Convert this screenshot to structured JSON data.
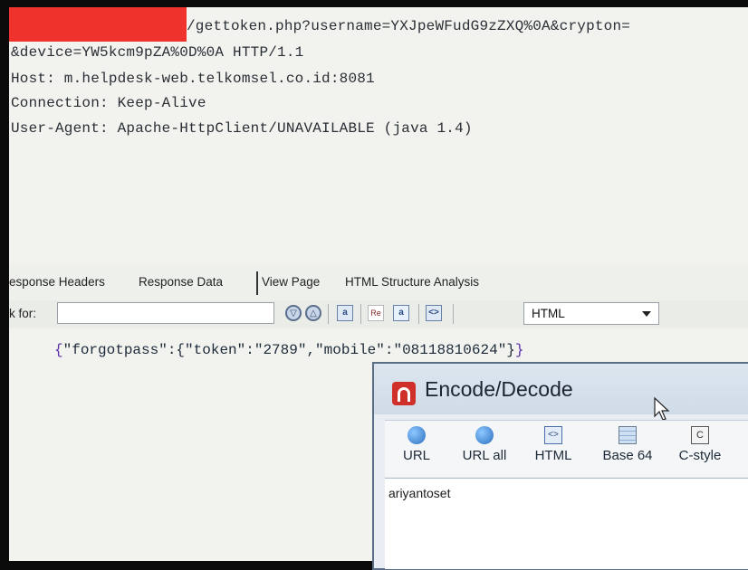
{
  "request": {
    "lines": [
      "/gettoken.php?username=YXJpeWFudG9zZXQ%0A&crypton=",
      "&device=YW5kcm9pZA%0D%0A HTTP/1.1",
      "Host: m.helpdesk-web.telkomsel.co.id:8081",
      "Connection: Keep-Alive",
      "User-Agent: Apache-HttpClient/UNAVAILABLE (java 1.4)"
    ]
  },
  "tabs": [
    {
      "label": "esponse Headers"
    },
    {
      "label": "Response Data"
    },
    {
      "label": "View Page"
    },
    {
      "label": "HTML Structure Analysis"
    }
  ],
  "toolbar": {
    "look_label": "k for:",
    "icons": [
      "search-down-icon",
      "search-up-icon",
      "match-case-icon",
      "regex-icon",
      "replace-icon",
      "html-tag-icon"
    ],
    "mode_value": "HTML"
  },
  "response": {
    "open": "{",
    "body": "\"forgotpass\":{\"token\":\"2789\",\"mobile\":\"08118810624\"}",
    "close": "}"
  },
  "dialog": {
    "title": "Encode/Decode",
    "buttons": [
      {
        "label": "URL",
        "icon": "globe-link-icon"
      },
      {
        "label": "URL all",
        "icon": "globe-link-icon"
      },
      {
        "label": "HTML",
        "icon": "html-tag-icon"
      },
      {
        "label": "Base 64",
        "icon": "grid-icon"
      },
      {
        "label": "C-style",
        "icon": "c-icon"
      }
    ],
    "text_value": "ariyantoset"
  },
  "colors": {
    "redaction": "#f0322c",
    "brace": "#5a2ea8",
    "logo": "#d0302a"
  }
}
